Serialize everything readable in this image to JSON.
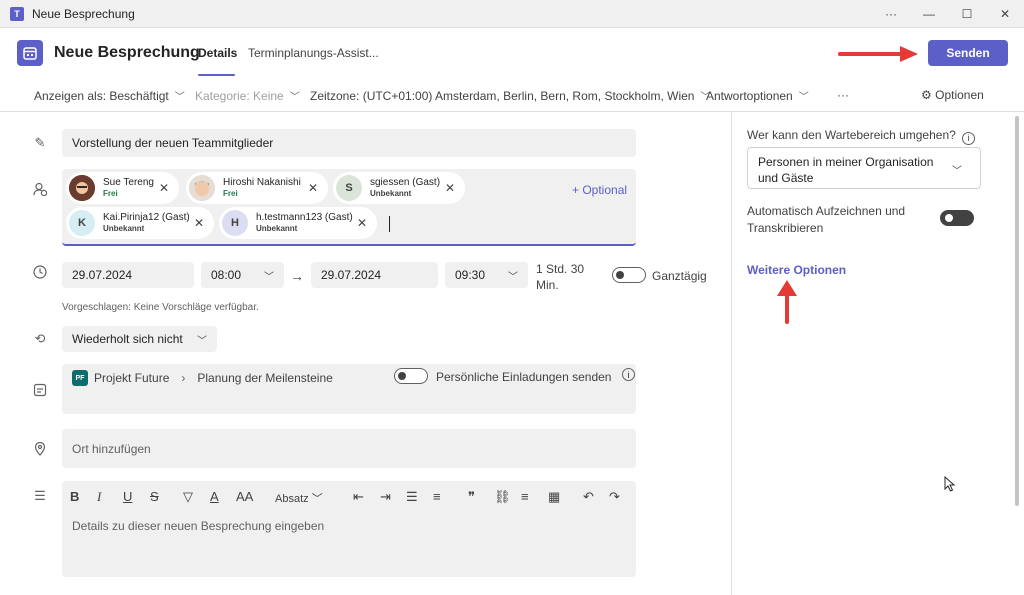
{
  "window": {
    "title": "Neue Besprechung",
    "controls": [
      "···",
      "—",
      "☐",
      "✕"
    ]
  },
  "header": {
    "title": "Neue Besprechung",
    "tabs": [
      {
        "label": "Details",
        "active": true
      },
      {
        "label": "Terminplanungs-Assist...",
        "active": false
      }
    ],
    "send_label": "Senden"
  },
  "toolbar": {
    "show_as": "Anzeigen als: Beschäftigt",
    "category": "Kategorie: Keine",
    "timezone": "Zeitzone: (UTC+01:00) Amsterdam, Berlin, Bern, Rom, Stockholm, Wien",
    "response_options": "Antwortoptionen",
    "more": "···",
    "options": "Optionen"
  },
  "form": {
    "title_value": "Vorstellung der neuen Teammitglieder",
    "attendees": [
      {
        "name": "Sue Tereng",
        "status": "Frei",
        "initial": "",
        "status_color": "#237b4b"
      },
      {
        "name": "Hiroshi Nakanishi",
        "status": "Frei",
        "initial": "",
        "status_color": "#237b4b"
      },
      {
        "name": "sgiessen (Gast)",
        "status": "Unbekannt",
        "initial": "S",
        "status_color": "#424242"
      },
      {
        "name": "Kai.Pirinja12 (Gast)",
        "status": "Unbekannt",
        "initial": "K",
        "status_color": "#424242"
      },
      {
        "name": "h.testmann123 (Gast)",
        "status": "Unbekannt",
        "initial": "H",
        "status_color": "#424242"
      }
    ],
    "optional_label": "+ Optional",
    "start_date": "29.07.2024",
    "start_time": "08:00",
    "end_date": "29.07.2024",
    "end_time": "09:30",
    "duration": "1 Std. 30 Min.",
    "all_day_label": "Ganztägig",
    "suggestion": "Vorgeschlagen: Keine Vorschläge verfügbar.",
    "recurrence": "Wiederholt sich nicht",
    "channel_badge": "PF",
    "channel_team": "Projekt Future",
    "channel_name": "Planung der Meilensteine",
    "personal_invites_label": "Persönliche Einladungen senden",
    "location_placeholder": "Ort hinzufügen",
    "paragraph_style": "Absatz",
    "details_placeholder": "Details zu dieser neuen Besprechung eingeben"
  },
  "side": {
    "lobby_label": "Wer kann den Wartebereich umgehen?",
    "lobby_value": "Personen in meiner Organisation und Gäste",
    "auto_record_label": "Automatisch Aufzeichnen und Transkribieren",
    "more_options": "Weitere Optionen"
  },
  "colors": {
    "accent": "#5b5fc7",
    "annotation_arrow": "#e53935"
  }
}
